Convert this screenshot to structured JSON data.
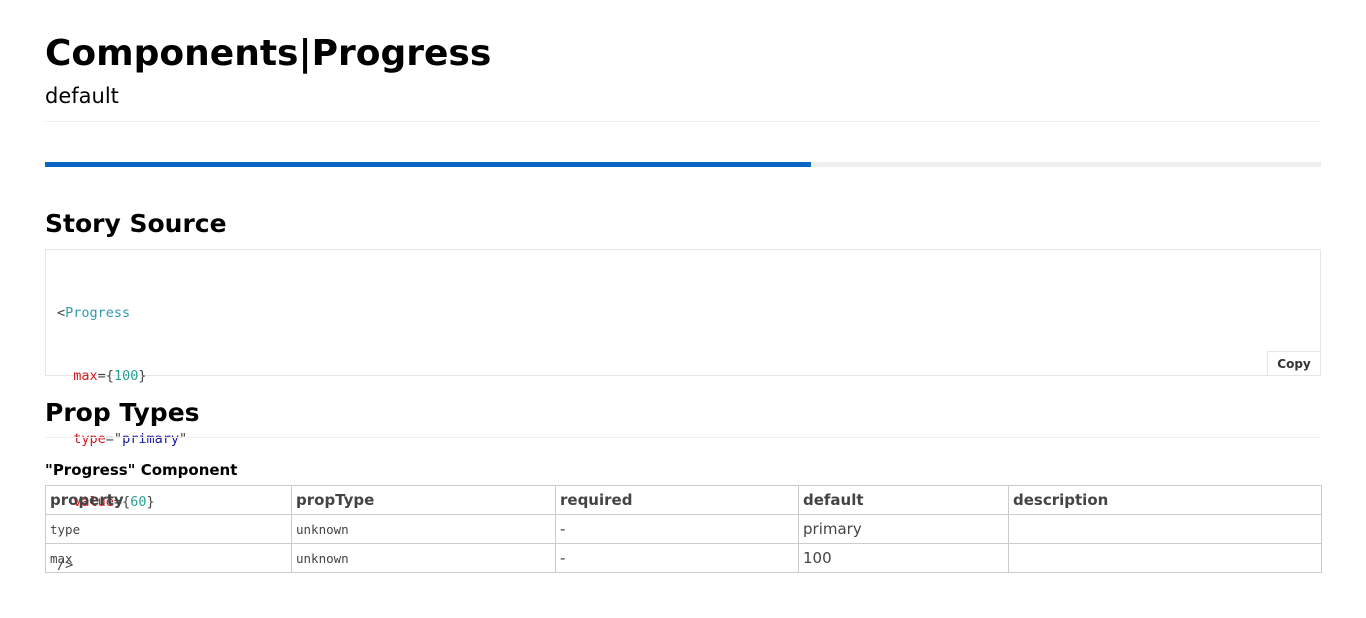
{
  "header": {
    "title": "Components|Progress",
    "subtitle": "default"
  },
  "progress_demo": {
    "value": 60,
    "max": 100,
    "accent_color": "#0b65c2",
    "track_color": "#eeeeee"
  },
  "story_source": {
    "heading": "Story Source",
    "code": {
      "open": "<",
      "component": "Progress",
      "attrs": [
        {
          "name": "max",
          "eq": "=",
          "open": "{",
          "value": "100",
          "close": "}"
        },
        {
          "name": "type",
          "eq": "=",
          "open": "\"",
          "value": "primary",
          "close": "\""
        },
        {
          "name": "value",
          "eq": "=",
          "open": "{",
          "value": "60",
          "close": "}"
        }
      ],
      "close": "/>"
    },
    "copy_label": "Copy"
  },
  "prop_types": {
    "heading": "Prop Types",
    "component_label": "\"Progress\" Component",
    "columns": [
      "property",
      "propType",
      "required",
      "default",
      "description"
    ],
    "rows": [
      {
        "property": "type",
        "propType": "unknown",
        "required": "-",
        "default": "primary",
        "description": ""
      },
      {
        "property": "max",
        "propType": "unknown",
        "required": "-",
        "default": "100",
        "description": ""
      }
    ]
  }
}
